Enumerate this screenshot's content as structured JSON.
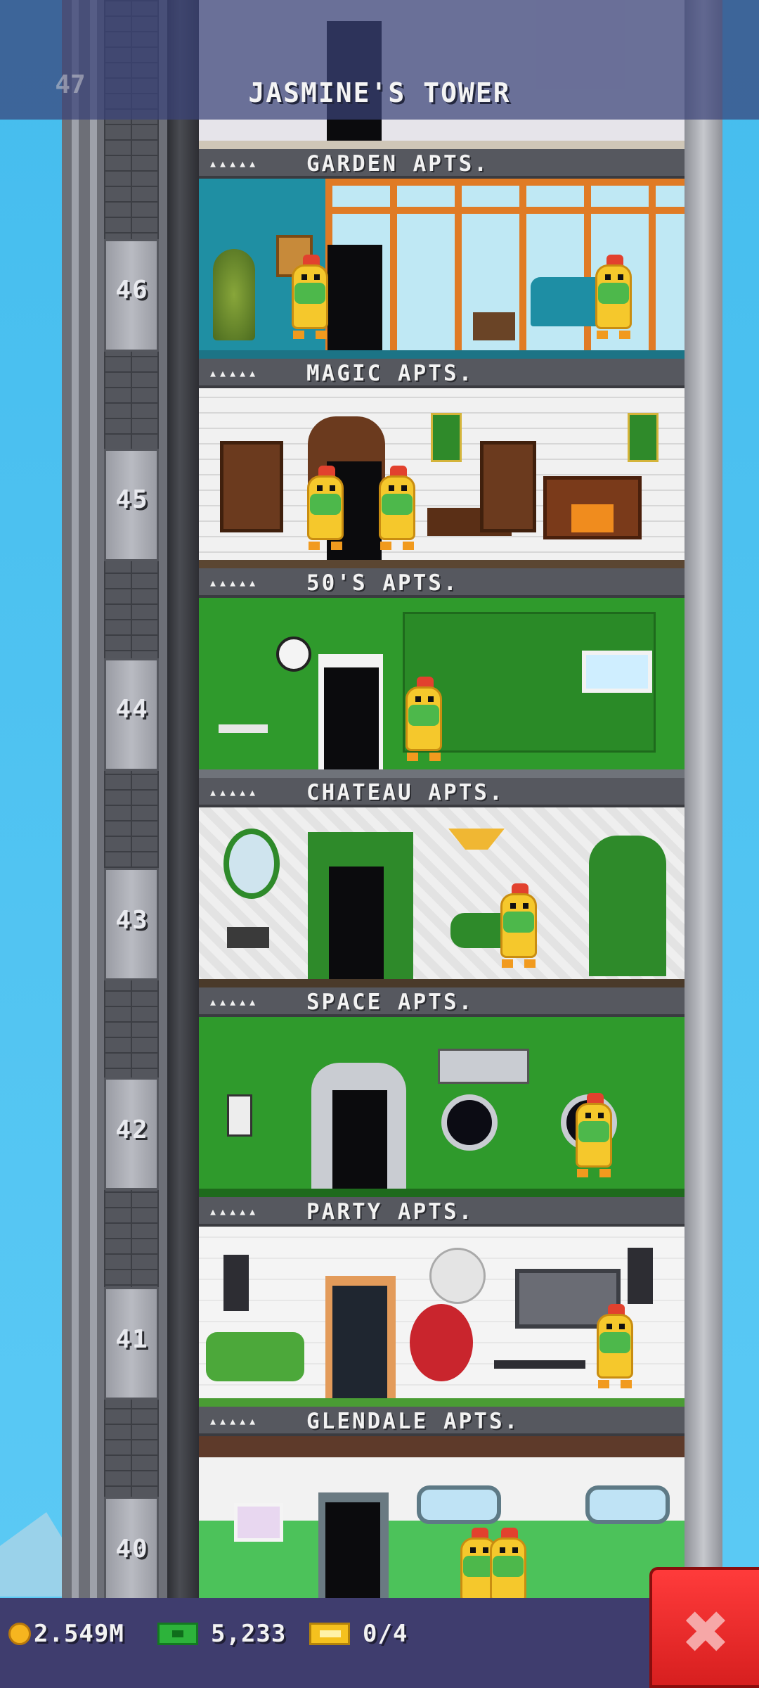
{
  "header": {
    "title": "JASMINE'S TOWER",
    "top_floor_number": "47"
  },
  "floors": [
    {
      "number": "46",
      "name": "GARDEN APTS.",
      "dots": "▴▴▴▴▴"
    },
    {
      "number": "45",
      "name": "MAGIC APTS.",
      "dots": "▴▴▴▴▴"
    },
    {
      "number": "44",
      "name": "50'S APTS.",
      "dots": "▴▴▴▴▴"
    },
    {
      "number": "43",
      "name": "CHATEAU APTS.",
      "dots": "▴▴▴▴▴"
    },
    {
      "number": "42",
      "name": "SPACE APTS.",
      "dots": "▴▴▴▴▴"
    },
    {
      "number": "41",
      "name": "PARTY APTS.",
      "dots": "▴▴▴▴▴"
    },
    {
      "number": "40",
      "name": "GLENDALE APTS.",
      "dots": "▴▴▴▴▴"
    }
  ],
  "footer": {
    "coins": "2.549M",
    "bux": "5,233",
    "tickets": "0/4",
    "coin_icon": "coin-icon",
    "bux_icon": "tower-bux-icon",
    "ticket_icon": "vip-ticket-icon",
    "close_icon": "close-icon"
  },
  "colors": {
    "sky": "#4cc3f0",
    "header_bg": "#3a4278",
    "footer_bg": "#3f3d6e",
    "close_button": "#e02828"
  }
}
